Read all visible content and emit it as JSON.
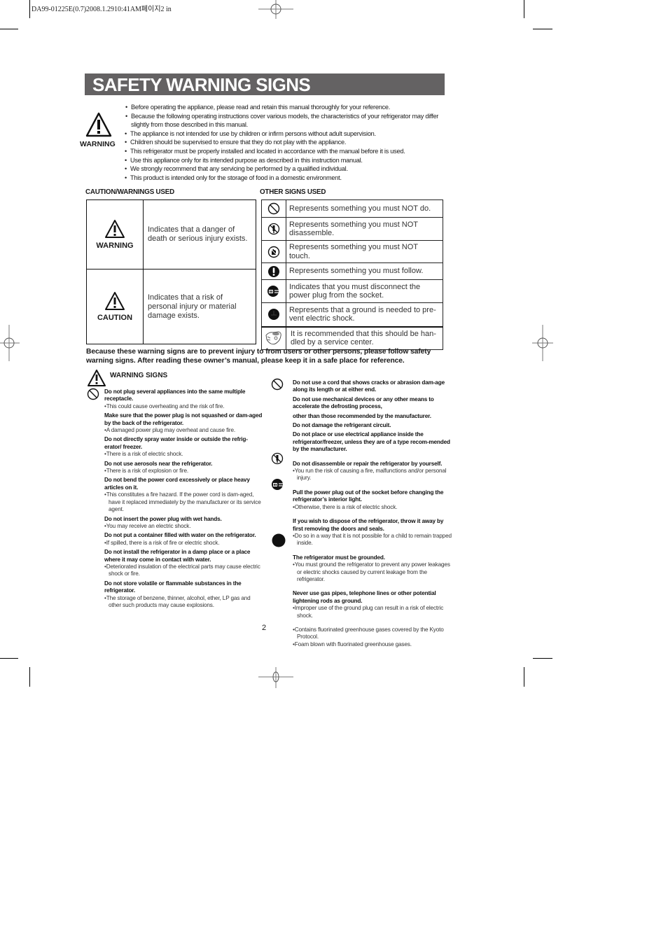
{
  "print_slug": "DA99-01225E(0.7)2008.1.2910:41AM페이지2  in",
  "title": "SAFETY WARNING SIGNS",
  "intro": {
    "icon": "warning-triangle-icon",
    "label": "WARNING",
    "bullets": [
      "Before operating the appliance, please read and retain this manual thoroughly for your reference.",
      "Because the following operating instructions cover various models, the characteristics of your refrigerator may differ slightly from those described in this manual.",
      "The appliance is not intended for use by children or infirm persons without adult supervision.",
      "Children should be supervised to ensure that they do not play with the appliance.",
      "This refrigerator must be properly installed and located in accordance with the manual before it is used.",
      "Use this appliance only for its intended purpose as described in this instruction manual.",
      "We strongly recommend that any servicing be performed by a qualified individual.",
      "This product is intended only for the storage of food in a domestic environment."
    ]
  },
  "caution_warnings": {
    "heading": "CAUTION/WARNINGS USED",
    "rows": [
      {
        "icon": "warning-triangle-icon",
        "label": "WARNING",
        "text": "Indicates that a danger of death or serious injury exists."
      },
      {
        "icon": "caution-triangle-icon",
        "label": "CAUTION",
        "text": "Indicates that a risk of personal injury or material damage exists."
      }
    ]
  },
  "other_signs": {
    "heading": "OTHER SIGNS USED",
    "rows": [
      {
        "icon": "prohibited-icon",
        "text": "Represents something you must NOT do."
      },
      {
        "icon": "no-disassemble-icon",
        "text": "Represents something you must NOT disassemble."
      },
      {
        "icon": "no-touch-icon",
        "text": "Represents something you must NOT touch."
      },
      {
        "icon": "must-follow-icon",
        "text": "Represents something you must follow."
      },
      {
        "icon": "unplug-icon",
        "text": "Indicates that you must disconnect the power plug from the socket."
      },
      {
        "icon": "ground-icon",
        "text": "Represents that a ground is needed to pre-vent electric shock."
      },
      {
        "icon": "service-center-icon",
        "text": "It is recommended that this should be han-dled by a service center."
      }
    ]
  },
  "notice": "Because these warning signs are to prevent injury to from users or other persons, please follow safety warning signs. After reading these owner’s manual, please keep it in a safe place for reference.",
  "warning_signs": {
    "heading": "WARNING SIGNS",
    "left": [
      {
        "title": "Do not plug several appliances into the same multiple receptacle.",
        "note": "This could cause overheating and the risk of fire."
      },
      {
        "title": "Make sure that the power plug is not squashed or dam-aged by the back of the refrigerator.",
        "note": "A damaged power plug may overheat and cause fire."
      },
      {
        "title": "Do not directly spray water inside or outside the refrig-erator/ freezer.",
        "note": "There is a risk of electric shock."
      },
      {
        "title": "Do not use aerosols near the refrigerator.",
        "note": "There is a risk of explosion or fire."
      },
      {
        "title": "Do not bend the power cord excessively or place heavy articles on it.",
        "note": "This constitutes a fire hazard. If the power cord is dam-aged, have it replaced immediately by the manufacturer or its service agent."
      },
      {
        "title": "Do not insert the power plug with wet hands.",
        "note": "You may receive an electric shock."
      },
      {
        "title": "Do not put a container filled with water on the refrigerator.",
        "note": "If spilled, there is a risk of fire or electric shock."
      },
      {
        "title": "Do not install the refrigerator  in a damp place or a place where it may come in contact with water.",
        "note": "Deteriorated insulation of the electrical parts may cause electric shock or fire."
      },
      {
        "title": "Do not store volatile or flammable substances in the refrigerator.",
        "note": "The storage of benzene, thinner, alcohol, ether, LP gas and other such products may cause explosions."
      }
    ],
    "right": {
      "prohibited": [
        "Do not use a cord that shows cracks or abrasion dam-age along its length or at either end.",
        "Do not use mechanical devices or any other means to accelerate the defrosting process,",
        "other than those recommended by the manufacturer.",
        "Do not damage the refrigerant circuit.",
        "Do not place or use electrical appliance inside the refrigerator/freezer, unless they are of a type recom-mended by the manufacturer."
      ],
      "disassemble": {
        "title": "Do not disassemble or repair the refrigerator by yourself.",
        "note": "You run the risk of causing a fire, malfunctions and/or personal injury."
      },
      "unplug": [
        {
          "title": "Pull the power plug out of the socket before changing the refrigerator’s interior light.",
          "note": "Otherwise, there is a risk of electric shock."
        },
        {
          "title": "If you wish to dispose of the refrigerator, throw it away by first removing the doors and seals.",
          "note": "Do so in a way that it is not possible for a child to remain trapped  inside."
        }
      ],
      "ground": [
        {
          "title": "The refrigerator must be grounded.",
          "note": "You must ground the refrigerator to prevent any power leakages or electric shocks caused by current leakage from the refrigerator."
        },
        {
          "title": "Never use gas pipes, telephone lines or other potential lightening rods as ground.",
          "note": "Improper use of the ground plug can result in a risk of electric shock."
        }
      ],
      "env_notes": [
        "Contains fluorinated greenhouse gases covered by the Kyoto Protocol.",
        "Foam blown with fluorinated greenhouse gases."
      ]
    }
  },
  "page_number": "2"
}
